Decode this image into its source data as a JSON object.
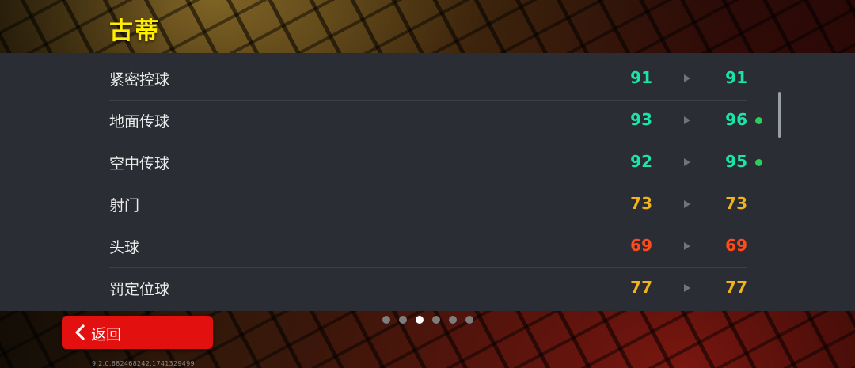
{
  "player": {
    "name": "古蒂"
  },
  "colors": {
    "green": "#19e6a6",
    "yellow": "#f2b21b",
    "red": "#ff4a1c",
    "dot": "#2ecc5a"
  },
  "stats": [
    {
      "label": "紧密控球",
      "before": "91",
      "after": "91",
      "color": "green",
      "improved": false
    },
    {
      "label": "地面传球",
      "before": "93",
      "after": "96",
      "color": "green",
      "improved": true
    },
    {
      "label": "空中传球",
      "before": "92",
      "after": "95",
      "color": "green",
      "improved": true
    },
    {
      "label": "射门",
      "before": "73",
      "after": "73",
      "color": "yellow",
      "improved": false
    },
    {
      "label": "头球",
      "before": "69",
      "after": "69",
      "color": "red",
      "improved": false
    },
    {
      "label": "罚定位球",
      "before": "77",
      "after": "77",
      "color": "yellow",
      "improved": false
    }
  ],
  "pager": {
    "count": 6,
    "active_index": 2
  },
  "back_button": {
    "label": "返回",
    "icon": "chevron-left-icon"
  },
  "version": "9.2.0.682468242.1741329499"
}
